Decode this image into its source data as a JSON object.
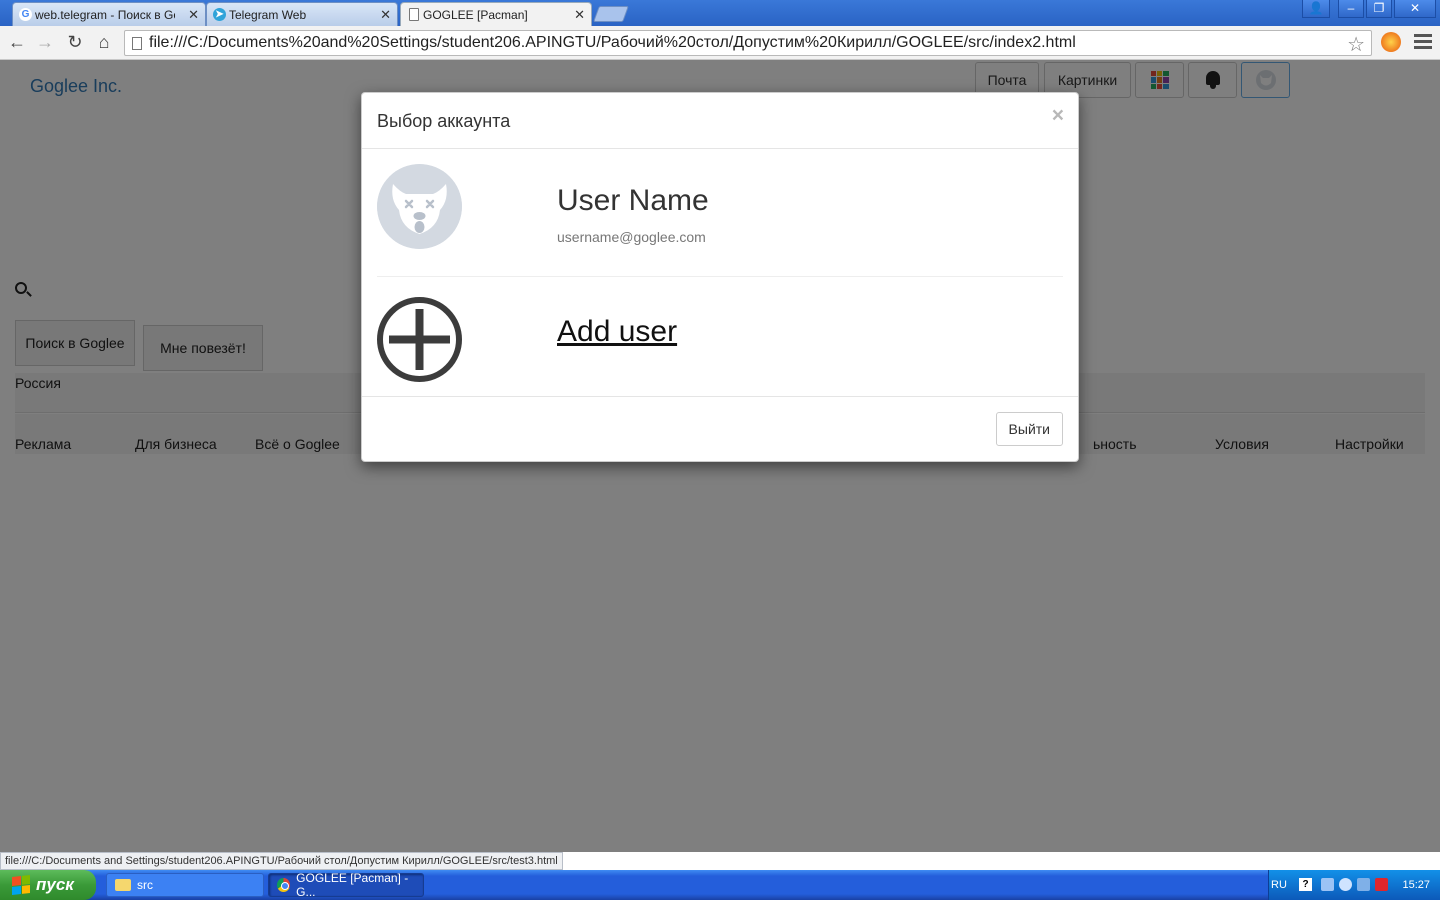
{
  "browser": {
    "tabs": [
      {
        "title": "web.telegram - Поиск в Goo",
        "favicon": "google-icon"
      },
      {
        "title": "Telegram Web",
        "favicon": "telegram-icon"
      },
      {
        "title": "GOGLEE [Pacman]",
        "favicon": "page-icon",
        "active": true
      }
    ],
    "url": "file:///C:/Documents%20and%20Settings/student206.APINGTU/Рабочий%20стол/Допустим%20Кирилл/GOGLEE/src/index2.html",
    "status_url": "file:///C:/Documents and Settings/student206.APINGTU/Рабочий стол/Допустим Кирилл/GOGLEE/src/test3.html"
  },
  "page": {
    "brand": "Goglee Inc.",
    "top_nav": {
      "mail": "Почта",
      "images": "Картинки"
    },
    "search_button": "Поиск в Goglee",
    "lucky_button": "Мне повезёт!",
    "country": "Россия",
    "footer_links": [
      {
        "label": "Реклама"
      },
      {
        "label": "Для бизнеса"
      },
      {
        "label": "Всё о Goglee"
      },
      {
        "label": "ьность"
      },
      {
        "label": "Условия"
      },
      {
        "label": "Настройки"
      }
    ]
  },
  "modal": {
    "title": "Выбор аккаунта",
    "close": "×",
    "account": {
      "name": "User Name",
      "email": "username@goglee.com"
    },
    "add_user": "Add user",
    "logout": "Выйти"
  },
  "taskbar": {
    "start": "пуск",
    "tasks": [
      {
        "label": "src",
        "icon": "folder-icon"
      },
      {
        "label": "GOGLEE [Pacman] - G...",
        "icon": "chrome-icon"
      }
    ],
    "lang": "RU",
    "time": "15:27"
  },
  "colors": {
    "link": "#337ab7",
    "backdrop": "rgba(0,0,0,0.5)",
    "taskbar": "#245edb",
    "start": "#3a9a38"
  }
}
